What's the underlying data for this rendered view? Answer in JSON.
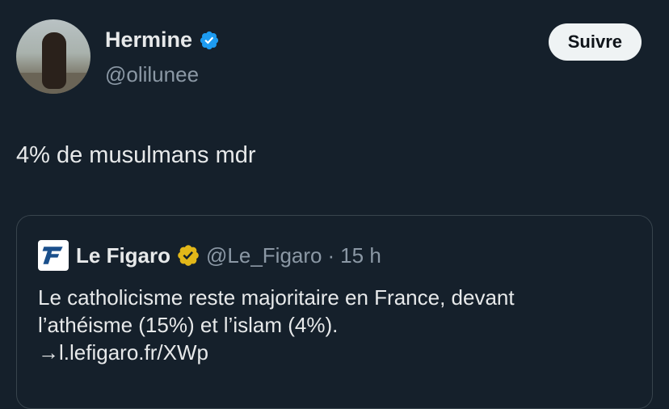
{
  "author": {
    "display_name": "Hermine",
    "handle": "@olilunee",
    "avatar_icon": "profile-photo",
    "verified_color": "#1d9bf0"
  },
  "follow_button": {
    "label": "Suivre"
  },
  "tweet": {
    "text": "4% de musulmans mdr"
  },
  "quoted": {
    "logo_icon": "le-figaro-logo",
    "name": "Le Figaro",
    "verified_color": "#e2b719",
    "handle": "@Le_Figaro",
    "separator": "·",
    "time": "15 h",
    "text_lines": [
      "Le catholicisme reste majoritaire en France, devant",
      "l’athéisme (15%) et l’islam (4%).",
      "→l.lefigaro.fr/XWp"
    ]
  },
  "colors": {
    "background": "#15202b",
    "text": "#e7e9ea",
    "secondary_text": "#8b98a5",
    "card_border": "#38444d"
  }
}
